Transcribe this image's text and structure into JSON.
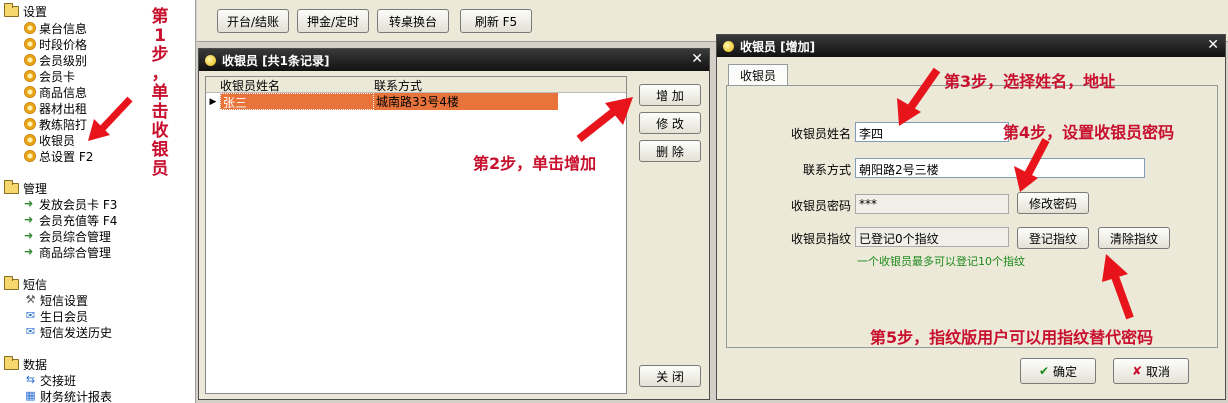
{
  "sidebar": {
    "groups": [
      {
        "label": "设置",
        "items": [
          "桌台信息",
          "时段价格",
          "会员级别",
          "会员卡",
          "商品信息",
          "器材出租",
          "教练陪打",
          "收银员",
          "总设置 F2"
        ]
      },
      {
        "label": "管理",
        "items": [
          "发放会员卡 F3",
          "会员充值等 F4",
          "会员综合管理",
          "商品综合管理"
        ]
      },
      {
        "label": "短信",
        "items": [
          "短信设置",
          "生日会员",
          "短信发送历史"
        ]
      },
      {
        "label": "数据",
        "items": [
          "交接班",
          "财务统计报表"
        ]
      }
    ]
  },
  "toolbar": {
    "open": "开台/结账",
    "deposit": "押金/定时",
    "switch": "转桌换台",
    "refresh": "刷新 F5"
  },
  "list_window": {
    "title": "收银员 [共1条记录]",
    "columns": [
      "收银员姓名",
      "联系方式"
    ],
    "rows": [
      {
        "name": "张三",
        "contact": "城南路33号4楼"
      }
    ],
    "buttons": {
      "add": "增 加",
      "edit": "修 改",
      "delete": "删 除",
      "close": "关 闭"
    }
  },
  "add_window": {
    "title": "收银员 [增加]",
    "tab": "收银员",
    "name_label": "收银员姓名",
    "name_value": "李四",
    "contact_label": "联系方式",
    "contact_value": "朝阳路2号三楼",
    "password_label": "收银员密码",
    "password_value": "***",
    "change_password": "修改密码",
    "fingerprint_label": "收银员指纹",
    "fingerprint_value": "已登记0个指纹",
    "register_fp": "登记指纹",
    "clear_fp": "清除指纹",
    "fp_note": "一个收银员最多可以登记10个指纹",
    "ok": "确定",
    "cancel": "取消"
  },
  "annotations": {
    "step1": [
      "第",
      "1",
      "步",
      "，",
      "单",
      "击",
      "收",
      "银",
      "员"
    ],
    "step2": "第2步，单击增加",
    "step3": "第3步，选择姓名，地址",
    "step4": "第4步，设置收银员密码",
    "step5": "第5步，指纹版用户可以用指纹替代密码"
  },
  "colors": {
    "annotation": "#c8102e",
    "selected_row": "#e8743b",
    "titlebar": "#1a1a1a",
    "note_green": "#1a8a1a"
  }
}
